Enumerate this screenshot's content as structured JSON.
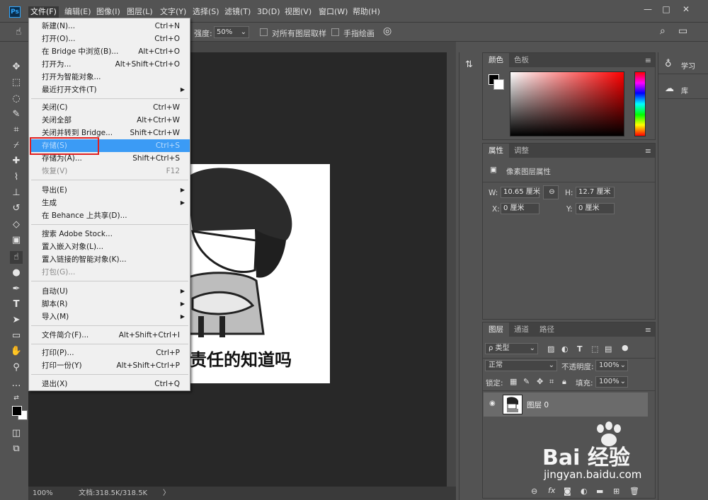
{
  "app": {
    "logo": "Ps"
  },
  "menubar": {
    "items": [
      "文件(F)",
      "编辑(E)",
      "图像(I)",
      "图层(L)",
      "文字(Y)",
      "选择(S)",
      "滤镜(T)",
      "3D(D)",
      "视图(V)",
      "窗口(W)",
      "帮助(H)"
    ]
  },
  "window_controls": {
    "minimize": "—",
    "maximize": "□",
    "close": "✕"
  },
  "options": {
    "strength_label": "强度:",
    "strength_value": "50%",
    "sample_all_layers": "对所有图层取样",
    "finger_painting": "手指绘画"
  },
  "file_menu": {
    "items": [
      {
        "label": "新建(N)...",
        "shortcut": "Ctrl+N"
      },
      {
        "label": "打开(O)...",
        "shortcut": "Ctrl+O"
      },
      {
        "label": "在 Bridge 中浏览(B)...",
        "shortcut": "Alt+Ctrl+O"
      },
      {
        "label": "打开为...",
        "shortcut": "Alt+Shift+Ctrl+O"
      },
      {
        "label": "打开为智能对象...",
        "shortcut": ""
      },
      {
        "label": "最近打开文件(T)",
        "shortcut": ""
      },
      {
        "label": "关闭(C)",
        "shortcut": "Ctrl+W"
      },
      {
        "label": "关闭全部",
        "shortcut": "Alt+Ctrl+W"
      },
      {
        "label": "关闭并转到 Bridge...",
        "shortcut": "Shift+Ctrl+W"
      },
      {
        "label": "存储(S)",
        "shortcut": "Ctrl+S"
      },
      {
        "label": "存储为(A)...",
        "shortcut": "Shift+Ctrl+S"
      },
      {
        "label": "恢复(V)",
        "shortcut": "F12"
      },
      {
        "label": "导出(E)",
        "shortcut": ""
      },
      {
        "label": "生成",
        "shortcut": ""
      },
      {
        "label": "在 Behance 上共享(D)...",
        "shortcut": ""
      },
      {
        "label": "搜索 Adobe Stock...",
        "shortcut": ""
      },
      {
        "label": "置入嵌入对象(L)...",
        "shortcut": ""
      },
      {
        "label": "置入链接的智能对象(K)...",
        "shortcut": ""
      },
      {
        "label": "打包(G)...",
        "shortcut": ""
      },
      {
        "label": "自动(U)",
        "shortcut": ""
      },
      {
        "label": "脚本(R)",
        "shortcut": ""
      },
      {
        "label": "导入(M)",
        "shortcut": ""
      },
      {
        "label": "文件简介(F)...",
        "shortcut": "Alt+Shift+Ctrl+I"
      },
      {
        "label": "打印(P)...",
        "shortcut": "Ctrl+P"
      },
      {
        "label": "打印一份(Y)",
        "shortcut": "Alt+Shift+Ctrl+P"
      },
      {
        "label": "退出(X)",
        "shortcut": "Ctrl+Q"
      }
    ]
  },
  "canvas": {
    "caption": "责任的知道吗"
  },
  "status": {
    "zoom": "100%",
    "doc": "文档:318.5K/318.5K",
    "arrow": "〉"
  },
  "color_panel": {
    "tabs": [
      "颜色",
      "色板"
    ]
  },
  "properties_panel": {
    "tabs": [
      "属性",
      "调整"
    ],
    "title": "像素图层属性",
    "w_label": "W:",
    "w_value": "10.65 厘米",
    "h_label": "H:",
    "h_value": "12.7 厘米",
    "x_label": "X:",
    "x_value": "0 厘米",
    "y_label": "Y:",
    "y_value": "0 厘米"
  },
  "layers_panel": {
    "tabs": [
      "图层",
      "通道",
      "路径"
    ],
    "filter": "ρ 类型",
    "blend_mode": "正常",
    "opacity_label": "不透明度:",
    "opacity_value": "100%",
    "lock_label": "锁定:",
    "fill_label": "填充:",
    "fill_value": "100%",
    "layer_name": "图层 0"
  },
  "learn_panel": {
    "learn": "学习",
    "library": "库"
  },
  "watermark": {
    "brand": "Bai  经验",
    "url": "jingyan.baidu.com"
  },
  "colors": {
    "menu_highlight": "#3b9bf5",
    "annotation_red": "#e02020"
  }
}
